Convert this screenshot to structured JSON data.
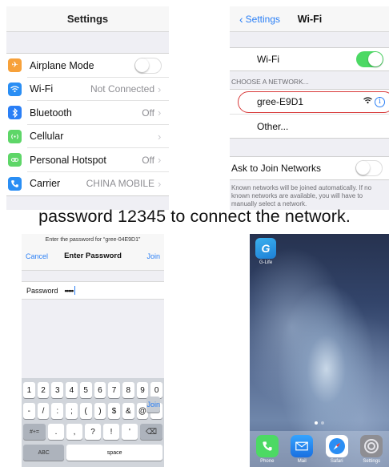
{
  "settings": {
    "title": "Settings",
    "rows": [
      {
        "label": "Airplane Mode",
        "value": "",
        "icon": "airplane-icon",
        "color": "#f7a13a",
        "glyph": "✈"
      },
      {
        "label": "Wi-Fi",
        "value": "Not Connected",
        "icon": "wifi-icon",
        "color": "#2a8ef4",
        "glyph": "⌁"
      },
      {
        "label": "Bluetooth",
        "value": "Off",
        "icon": "bluetooth-icon",
        "color": "#2a7ff6",
        "glyph": "ᛒ"
      },
      {
        "label": "Cellular",
        "value": "",
        "icon": "cellular-icon",
        "color": "#5ed668",
        "glyph": "◎"
      },
      {
        "label": "Personal Hotspot",
        "value": "Off",
        "icon": "hotspot-icon",
        "color": "#5ed668",
        "glyph": "∞"
      },
      {
        "label": "Carrier",
        "value": "CHINA MOBILE",
        "icon": "phone-icon",
        "color": "#2a8ef4",
        "glyph": "☎"
      }
    ]
  },
  "wifi": {
    "back_label": "Settings",
    "title": "Wi-Fi",
    "wifi_label": "Wi-Fi",
    "section": "CHOOSE A NETWORK...",
    "network_name": "gree-E9D1",
    "other_label": "Other...",
    "ask_label": "Ask to Join Networks",
    "note": "Known networks will be joined automatically. If no known networks are available, you will have to manually select a network."
  },
  "caption": "password 12345 to connect the network.",
  "password": {
    "prompt": "Enter the password for “gree-04E9D1”",
    "cancel": "Cancel",
    "title": "Enter Password",
    "join": "Join",
    "field_label": "Password",
    "field_value": "•••••",
    "keyboard": {
      "row1": [
        "1",
        "2",
        "3",
        "4",
        "5",
        "6",
        "7",
        "8",
        "9",
        "0"
      ],
      "row2": [
        "-",
        "/",
        ":",
        ";",
        "(",
        ")",
        "$",
        "&",
        "@",
        "”"
      ],
      "row3_left": "#+=",
      "row3": [
        ".",
        ",",
        "?",
        "!",
        "'"
      ],
      "delete": "⌫",
      "abc": "ABC",
      "space": "space",
      "join_key": "Join"
    }
  },
  "home": {
    "app_name": "G-Life",
    "app_glyph": "G",
    "dock": [
      {
        "label": "Phone",
        "icon": "phone-icon",
        "color": "#4cd964",
        "glyph": "☎"
      },
      {
        "label": "Mail",
        "icon": "mail-icon",
        "color": "#2a8ef4",
        "glyph": "✉"
      },
      {
        "label": "Safari",
        "icon": "compass-icon",
        "color": "#2a7ff6",
        "glyph": "✲"
      },
      {
        "label": "Settings",
        "icon": "gear-icon",
        "color": "#8e8e93",
        "glyph": "⚙"
      }
    ]
  }
}
